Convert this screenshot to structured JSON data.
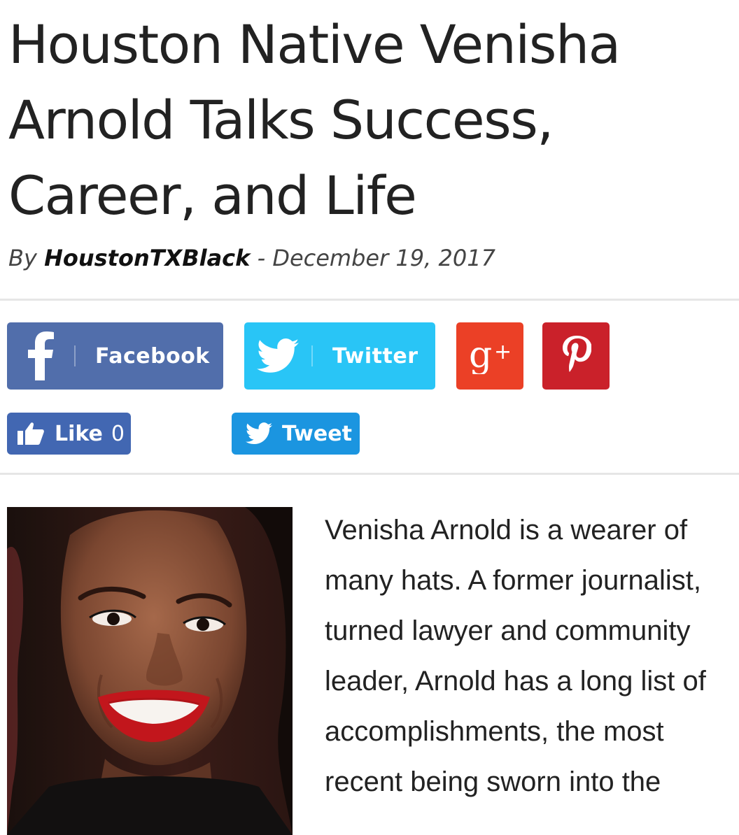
{
  "article": {
    "title": "Houston Native Venisha Arnold Talks Success, Career, and Life",
    "byline_prefix": "By",
    "author": "HoustonTXBlack",
    "byline_separator": "-",
    "date": "December 19, 2017",
    "body_text": "Venisha Arnold is a wearer of many hats. A former journalist, turned lawyer and community leader, Arnold has a long list of accomplishments, the most recent being sworn into the",
    "photo_icon": "portrait-photo"
  },
  "share": {
    "facebook": {
      "label": "Facebook",
      "icon": "facebook-icon",
      "color": "#516eab"
    },
    "twitter": {
      "label": "Twitter",
      "icon": "twitter-bird-icon",
      "color": "#29c5f6"
    },
    "googleplus": {
      "icon": "google-plus-icon",
      "color": "#eb4026"
    },
    "pinterest": {
      "icon": "pinterest-icon",
      "color": "#ca212a"
    }
  },
  "social_widgets": {
    "like": {
      "label": "Like",
      "count": "0",
      "icon": "thumbs-up-icon",
      "color": "#4267b2"
    },
    "tweet": {
      "label": "Tweet",
      "icon": "twitter-bird-icon",
      "color": "#1b95e0"
    }
  }
}
